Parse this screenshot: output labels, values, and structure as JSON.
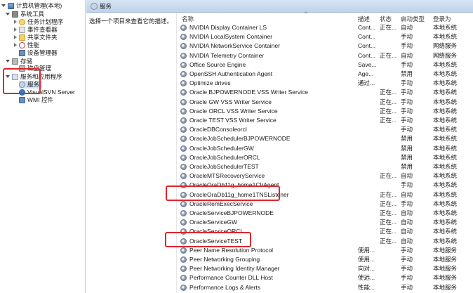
{
  "tree": {
    "root": "计算机管理(本地)",
    "items": [
      {
        "label": "系统工具",
        "icon": "tools-icon"
      },
      {
        "label": "任务计划程序",
        "icon": "clock-icon"
      },
      {
        "label": "事件查看器",
        "icon": "event-viewer-icon"
      },
      {
        "label": "共享文件夹",
        "icon": "folder-icon"
      },
      {
        "label": "性能",
        "icon": "performance-icon"
      },
      {
        "label": "设备管理器",
        "icon": "device-manager-icon"
      },
      {
        "label": "存储",
        "icon": "storage-icon"
      },
      {
        "label": "磁盘管理",
        "icon": "disk-icon"
      },
      {
        "label": "服务和应用程序",
        "icon": "services-apps-icon"
      },
      {
        "label": "服务",
        "icon": "gear-icon"
      },
      {
        "label": "VisualSVN Server",
        "icon": "svn-icon"
      },
      {
        "label": "WMI 控件",
        "icon": "wmi-icon"
      }
    ]
  },
  "pane": {
    "title": "服务",
    "description": "选择一个项目来查看它的描述。",
    "columns": {
      "name": "名称",
      "desc": "描述",
      "status": "状态",
      "startup": "启动类型",
      "logon": "登录为"
    }
  },
  "services": [
    {
      "name": "NVIDIA Display Container LS",
      "desc": "Cont...",
      "status": "正在...",
      "startup": "自动",
      "logon": "本地系统"
    },
    {
      "name": "NVIDIA LocalSystem Container",
      "desc": "Cont...",
      "status": "",
      "startup": "手动",
      "logon": "本地系统"
    },
    {
      "name": "NVIDIA NetworkService Container",
      "desc": "Cont...",
      "status": "",
      "startup": "手动",
      "logon": "网络服务"
    },
    {
      "name": "NVIDIA Telemetry Container",
      "desc": "Cont...",
      "status": "正在...",
      "startup": "自动",
      "logon": "网络服务"
    },
    {
      "name": "Office  Source Engine",
      "desc": "Save...",
      "status": "",
      "startup": "手动",
      "logon": "本地系统"
    },
    {
      "name": "OpenSSH Authentication Agent",
      "desc": "Age...",
      "status": "",
      "startup": "禁用",
      "logon": "本地系统"
    },
    {
      "name": "Optimize drives",
      "desc": "通过...",
      "status": "",
      "startup": "手动",
      "logon": "本地系统"
    },
    {
      "name": "Oracle BJPOWERNODE VSS Writer Service",
      "desc": "",
      "status": "正在...",
      "startup": "手动",
      "logon": "本地系统"
    },
    {
      "name": "Oracle GW VSS Writer Service",
      "desc": "",
      "status": "正在...",
      "startup": "手动",
      "logon": "本地系统"
    },
    {
      "name": "Oracle ORCL VSS Writer Service",
      "desc": "",
      "status": "正在...",
      "startup": "手动",
      "logon": "本地系统"
    },
    {
      "name": "Oracle TEST VSS Writer Service",
      "desc": "",
      "status": "正在...",
      "startup": "手动",
      "logon": "本地系统"
    },
    {
      "name": "OracleDBConsoleorcl",
      "desc": "",
      "status": "",
      "startup": "手动",
      "logon": "本地系统"
    },
    {
      "name": "OracleJobSchedulerBJPOWERNODE",
      "desc": "",
      "status": "",
      "startup": "禁用",
      "logon": "本地系统"
    },
    {
      "name": "OracleJobSchedulerGW",
      "desc": "",
      "status": "",
      "startup": "禁用",
      "logon": "本地系统"
    },
    {
      "name": "OracleJobSchedulerORCL",
      "desc": "",
      "status": "",
      "startup": "禁用",
      "logon": "本地系统"
    },
    {
      "name": "OracleJobSchedulerTEST",
      "desc": "",
      "status": "",
      "startup": "禁用",
      "logon": "本地系统"
    },
    {
      "name": "OracleMTSRecoveryService",
      "desc": "",
      "status": "正在...",
      "startup": "自动",
      "logon": "本地系统"
    },
    {
      "name": "OracleOraDb11g_home1ClrAgent",
      "desc": "",
      "status": "",
      "startup": "手动",
      "logon": "本地系统"
    },
    {
      "name": "OracleOraDb11g_home1TNSListener",
      "desc": "",
      "status": "正在...",
      "startup": "自动",
      "logon": "本地系统"
    },
    {
      "name": "OracleRemExecService",
      "desc": "",
      "status": "正在...",
      "startup": "手动",
      "logon": "本地系统"
    },
    {
      "name": "OracleServiceBJPOWERNODE",
      "desc": "",
      "status": "正在...",
      "startup": "自动",
      "logon": "本地系统"
    },
    {
      "name": "OracleServiceGW",
      "desc": "",
      "status": "正在...",
      "startup": "自动",
      "logon": "本地系统"
    },
    {
      "name": "OracleServiceORCL",
      "desc": "",
      "status": "正在...",
      "startup": "自动",
      "logon": "本地系统"
    },
    {
      "name": "OracleServiceTEST",
      "desc": "",
      "status": "正在...",
      "startup": "自动",
      "logon": "本地系统"
    },
    {
      "name": "Peer Name Resolution Protocol",
      "desc": "使用...",
      "status": "",
      "startup": "手动",
      "logon": "本地服务"
    },
    {
      "name": "Peer Networking Grouping",
      "desc": "使用...",
      "status": "",
      "startup": "手动",
      "logon": "本地服务"
    },
    {
      "name": "Peer Networking Identity Manager",
      "desc": "向对...",
      "status": "",
      "startup": "手动",
      "logon": "本地服务"
    },
    {
      "name": "Performance Counter DLL Host",
      "desc": "使远...",
      "status": "",
      "startup": "手动",
      "logon": "本地服务"
    },
    {
      "name": "Performance Logs & Alerts",
      "desc": "性能...",
      "status": "",
      "startup": "手动",
      "logon": "本地服务"
    }
  ],
  "colors": {
    "highlight": "#e0262a",
    "header": "#bed3ea",
    "selection": "#cde3f7"
  }
}
